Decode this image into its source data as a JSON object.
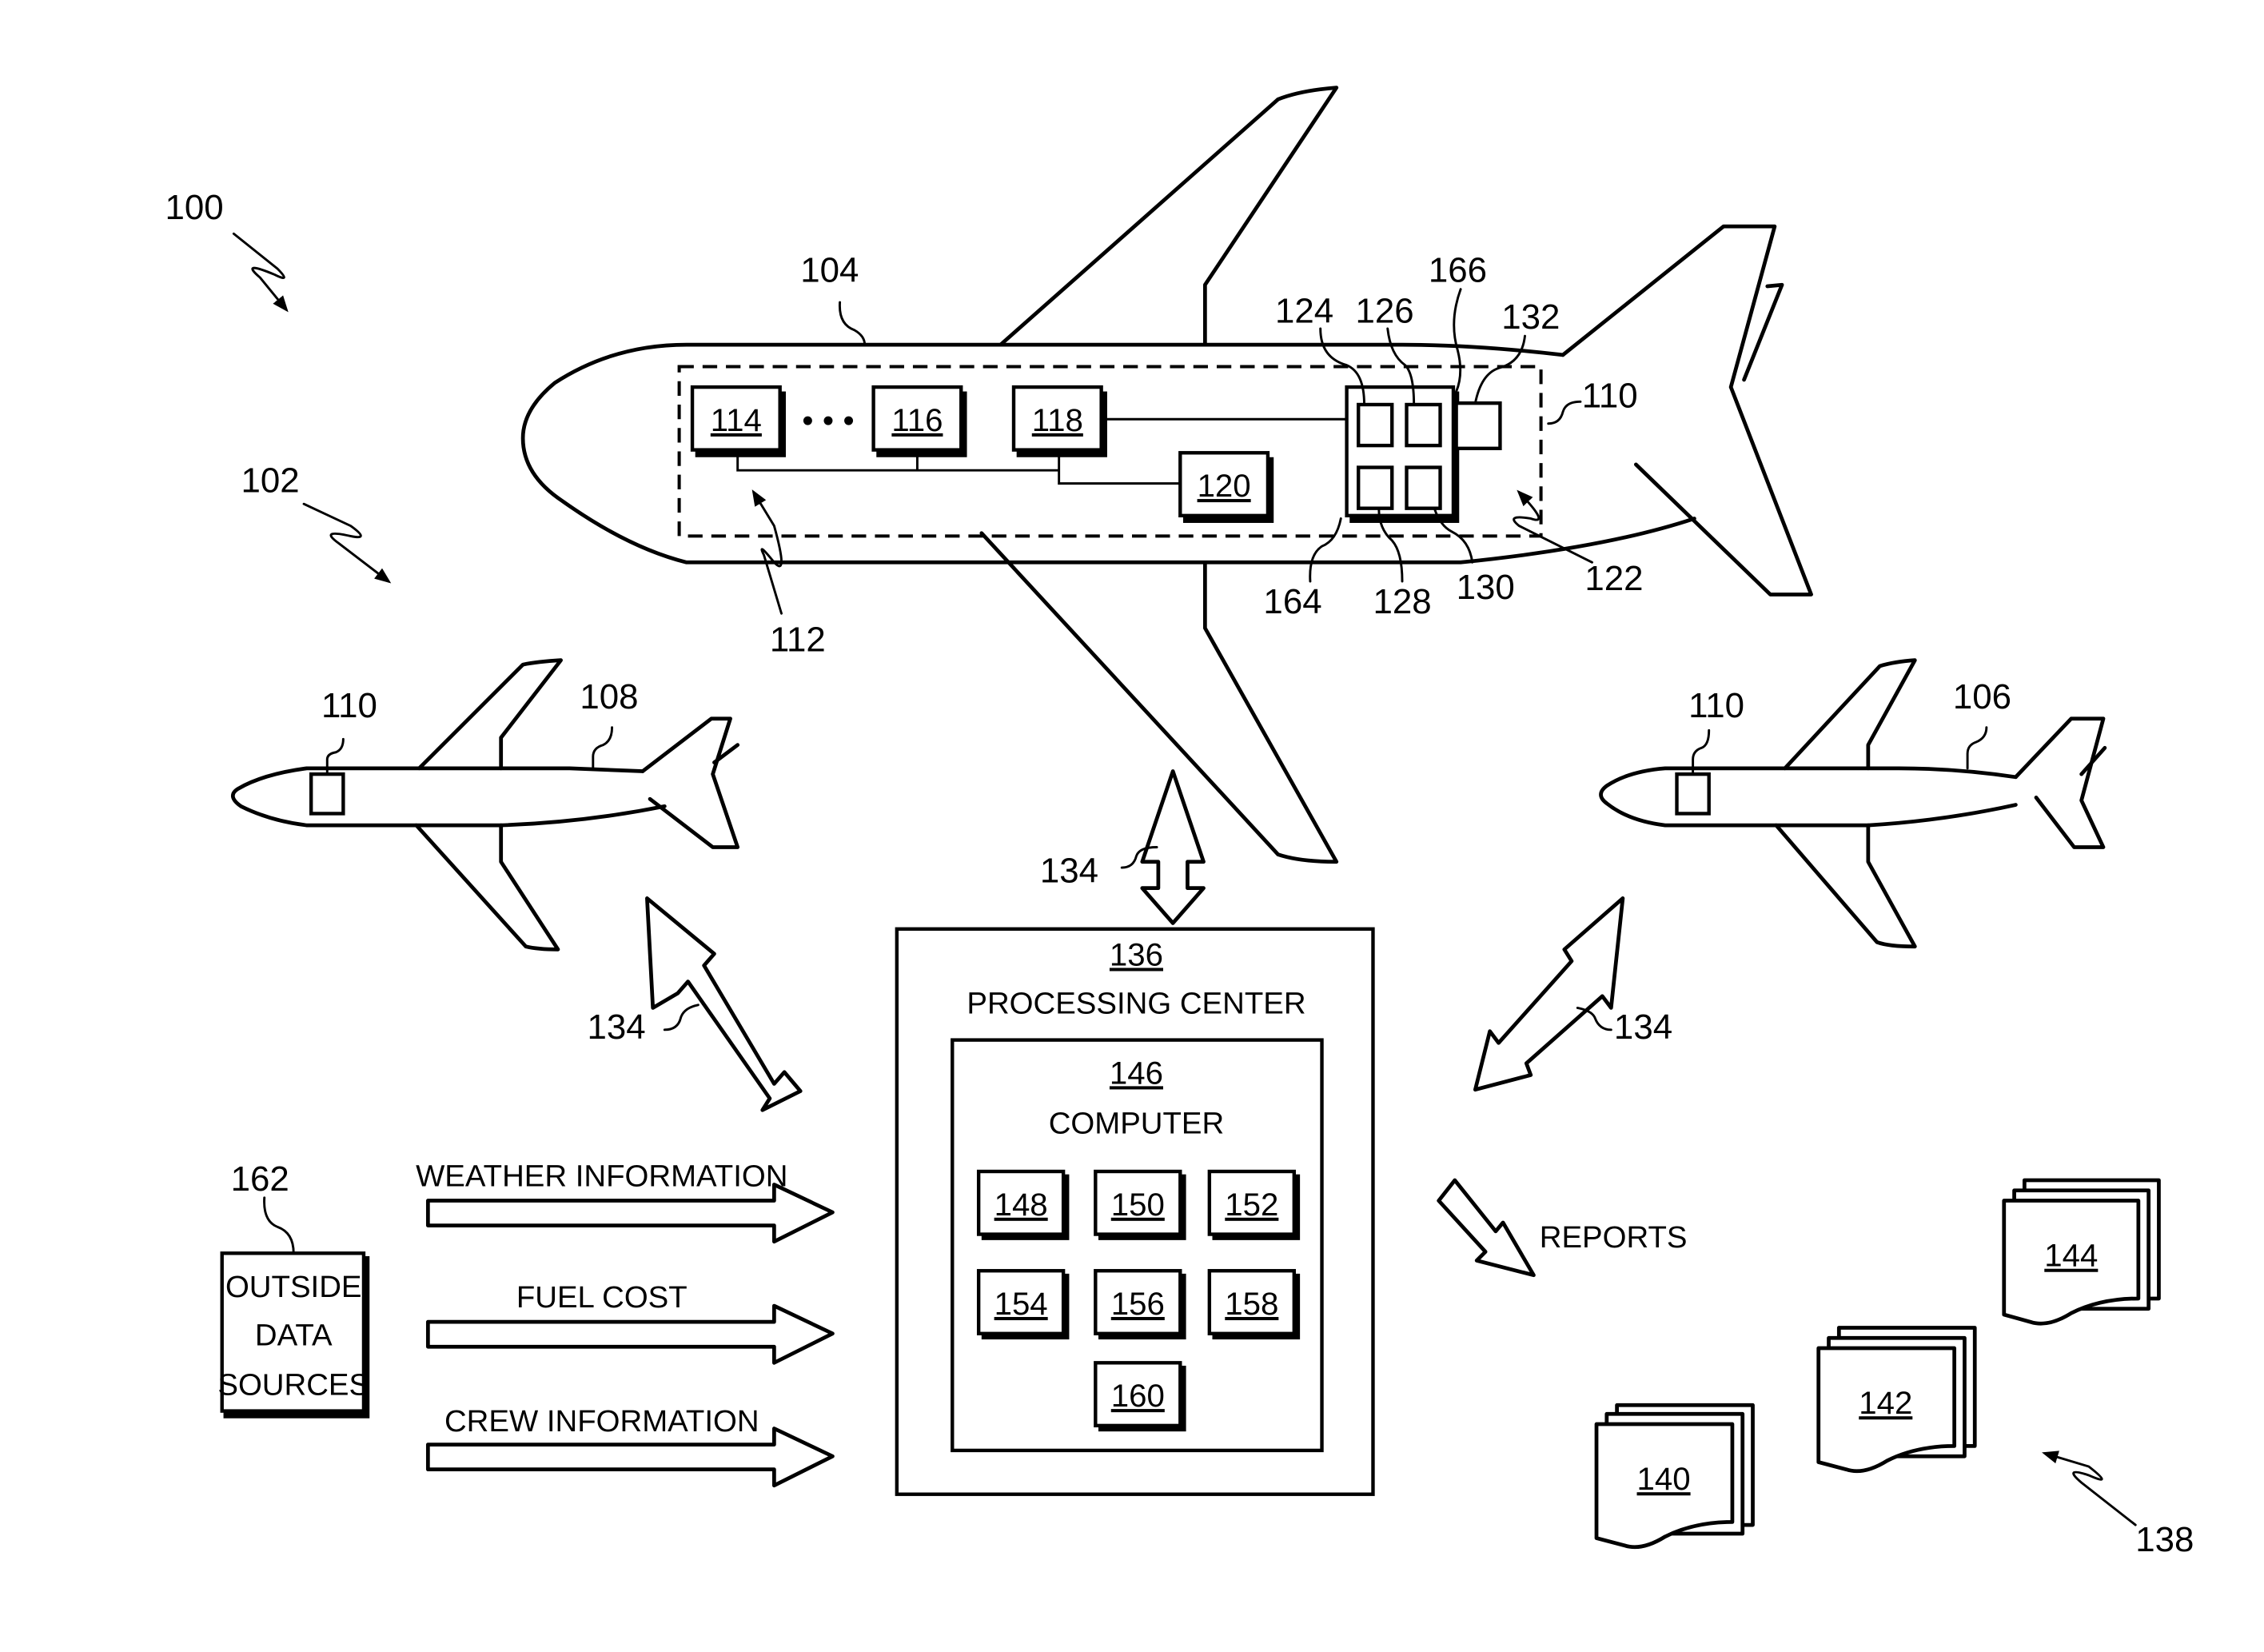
{
  "figure": {
    "system_ref": "100",
    "fleet_ref": "102"
  },
  "aircraft_main": {
    "ref": "104",
    "network_ref": "112",
    "device_ref": "110",
    "module_refs": [
      "114",
      "116",
      "118",
      "120"
    ],
    "ellipsis": "• • •",
    "processor_group_ref": "122",
    "processor_refs": {
      "top_left": "124",
      "top_right": "126",
      "bottom_left": "128",
      "bottom_right": "130",
      "side_unit": "132",
      "group_frame": "164",
      "connector": "166"
    }
  },
  "aircraft_left": {
    "ref": "108",
    "device_ref": "110"
  },
  "aircraft_right": {
    "ref": "106",
    "device_ref": "110"
  },
  "links": {
    "ref": "134"
  },
  "processing_center": {
    "ref": "136",
    "title": "PROCESSING CENTER",
    "computer": {
      "ref": "146",
      "title": "COMPUTER",
      "modules": [
        "148",
        "150",
        "152",
        "154",
        "156",
        "158",
        "160"
      ]
    }
  },
  "outside_data": {
    "ref": "162",
    "lines": [
      "OUTSIDE",
      "DATA",
      "SOURCES"
    ],
    "inputs": [
      "WEATHER INFORMATION",
      "FUEL COST",
      "CREW INFORMATION"
    ]
  },
  "reports": {
    "label": "REPORTS",
    "group_ref": "138",
    "documents": [
      "140",
      "142",
      "144"
    ]
  }
}
